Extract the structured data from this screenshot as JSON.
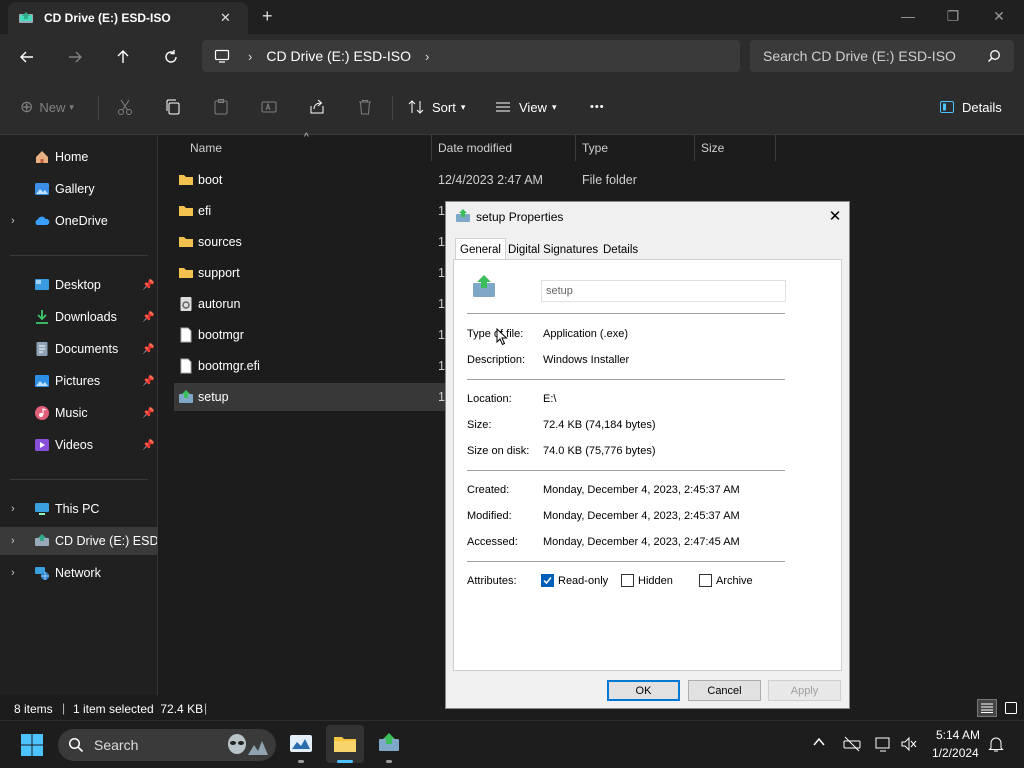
{
  "window": {
    "tab_title": "CD Drive (E:) ESD-ISO",
    "new_tab": "+",
    "minimize": "—",
    "maximize": "❐",
    "close": "✕"
  },
  "address": {
    "crumb": "CD Drive (E:) ESD-ISO",
    "search_placeholder": "Search CD Drive (E:) ESD-ISO"
  },
  "toolbar": {
    "new": "New",
    "sort": "Sort",
    "view": "View",
    "more": "•••",
    "details": "Details"
  },
  "sidebar": {
    "items": [
      {
        "label": "Home"
      },
      {
        "label": "Gallery"
      },
      {
        "label": "OneDrive"
      },
      {
        "label": "Desktop"
      },
      {
        "label": "Downloads"
      },
      {
        "label": "Documents"
      },
      {
        "label": "Pictures"
      },
      {
        "label": "Music"
      },
      {
        "label": "Videos"
      },
      {
        "label": "This PC"
      },
      {
        "label": "CD Drive (E:) ESD-ISO"
      },
      {
        "label": "Network"
      }
    ]
  },
  "filelist": {
    "columns": [
      "Name",
      "Date modified",
      "Type",
      "Size"
    ],
    "rows": [
      {
        "name": "boot",
        "date": "12/4/2023 2:47 AM",
        "type": "File folder"
      },
      {
        "name": "efi",
        "date": "1"
      },
      {
        "name": "sources",
        "date": "1/"
      },
      {
        "name": "support",
        "date": "1:"
      },
      {
        "name": "autorun",
        "date": "1:"
      },
      {
        "name": "bootmgr",
        "date": "1:"
      },
      {
        "name": "bootmgr.efi",
        "date": "1:"
      },
      {
        "name": "setup",
        "date": "1:"
      }
    ]
  },
  "statusbar": {
    "count": "8 items",
    "selection": "1 item selected  72.4 KB"
  },
  "taskbar": {
    "search": "Search",
    "time": "5:14 AM",
    "date": "1/2/2024"
  },
  "dialog": {
    "title": "setup Properties",
    "tabs": [
      "General",
      "Digital Signatures",
      "Details"
    ],
    "filename": "setup",
    "type_label": "Type of file:",
    "type_value": "Application (.exe)",
    "desc_label": "Description:",
    "desc_value": "Windows Installer",
    "location_label": "Location:",
    "location_value": "E:\\",
    "size_label": "Size:",
    "size_value": "72.4 KB (74,184 bytes)",
    "sizeondisk_label": "Size on disk:",
    "sizeondisk_value": "74.0 KB (75,776 bytes)",
    "created_label": "Created:",
    "created_value": "Monday, December 4, 2023, 2:45:37 AM",
    "modified_label": "Modified:",
    "modified_value": "Monday, December 4, 2023, 2:45:37 AM",
    "accessed_label": "Accessed:",
    "accessed_value": "Monday, December 4, 2023, 2:47:45 AM",
    "attributes_label": "Attributes:",
    "readonly": "Read-only",
    "hidden": "Hidden",
    "archive": "Archive",
    "ok": "OK",
    "cancel": "Cancel",
    "apply": "Apply"
  }
}
